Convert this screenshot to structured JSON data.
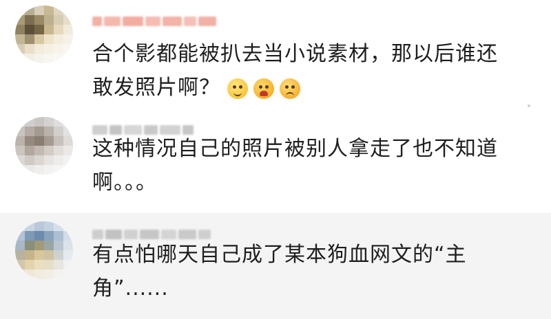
{
  "comments": [
    {
      "text_line1": "合个影都能被扒去当小说素材，那以后谁还",
      "text_line2": "敢发照片啊？",
      "emojis": [
        "smile-icon",
        "cry-icon",
        "angry-icon"
      ]
    },
    {
      "text_line1": "这种情况自己的照片被别人拿走了也不知道",
      "text_line2": "啊。。。"
    },
    {
      "text_line1": "有点怕哪天自己成了某本狗血网文的“主",
      "text_line2": "角”......"
    }
  ],
  "colors": {
    "text": "#1e1e1e",
    "highlight_row": "#f4f4f4",
    "username_tint_1": "#f5b3a8",
    "username_tint_2": "#c9c9c9"
  }
}
